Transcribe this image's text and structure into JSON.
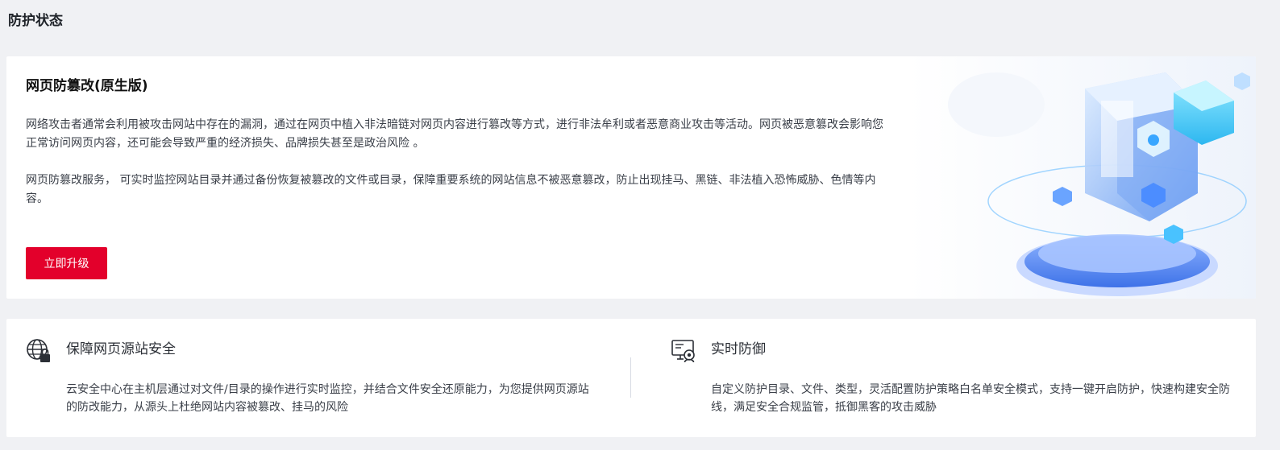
{
  "page": {
    "title": "防护状态"
  },
  "hero": {
    "title": "网页防篡改(原生版)",
    "desc1": "网络攻击者通常会利用被攻击网站中存在的漏洞，通过在网页中植入非法暗链对网页内容进行篡改等方式，进行非法牟利或者恶意商业攻击等活动。网页被恶意篡改会影响您正常访问网页内容，还可能会导致严重的经济损失、品牌损失甚至是政治风险 。",
    "desc2": "网页防篡改服务， 可实时监控网站目录并通过备份恢复被篡改的文件或目录，保障重要系统的网站信息不被恶意篡改，防止出现挂马、黑链、非法植入恐怖威胁、色情等内容。",
    "button_label": "立即升级",
    "button_color": "#e3002b"
  },
  "features": [
    {
      "icon": "globe-lock-icon",
      "title": "保障网页源站安全",
      "desc": "云安全中心在主机层通过对文件/目录的操作进行实时监控，并结合文件安全还原能力，为您提供网页源站的防改能力，从源头上杜绝网站内容被篡改、挂马的风险"
    },
    {
      "icon": "monitor-shield-icon",
      "title": "实时防御",
      "desc": "自定义防护目录、文件、类型，灵活配置防护策略白名单安全模式，支持一键开启防护，快速构建安全防线，满足安全合规监管，抵御黑客的攻击威胁"
    }
  ],
  "colors": {
    "background": "#f0f1f4",
    "card": "#ffffff",
    "accent": "#e3002b",
    "illustration_blue": "#4a8cff"
  }
}
